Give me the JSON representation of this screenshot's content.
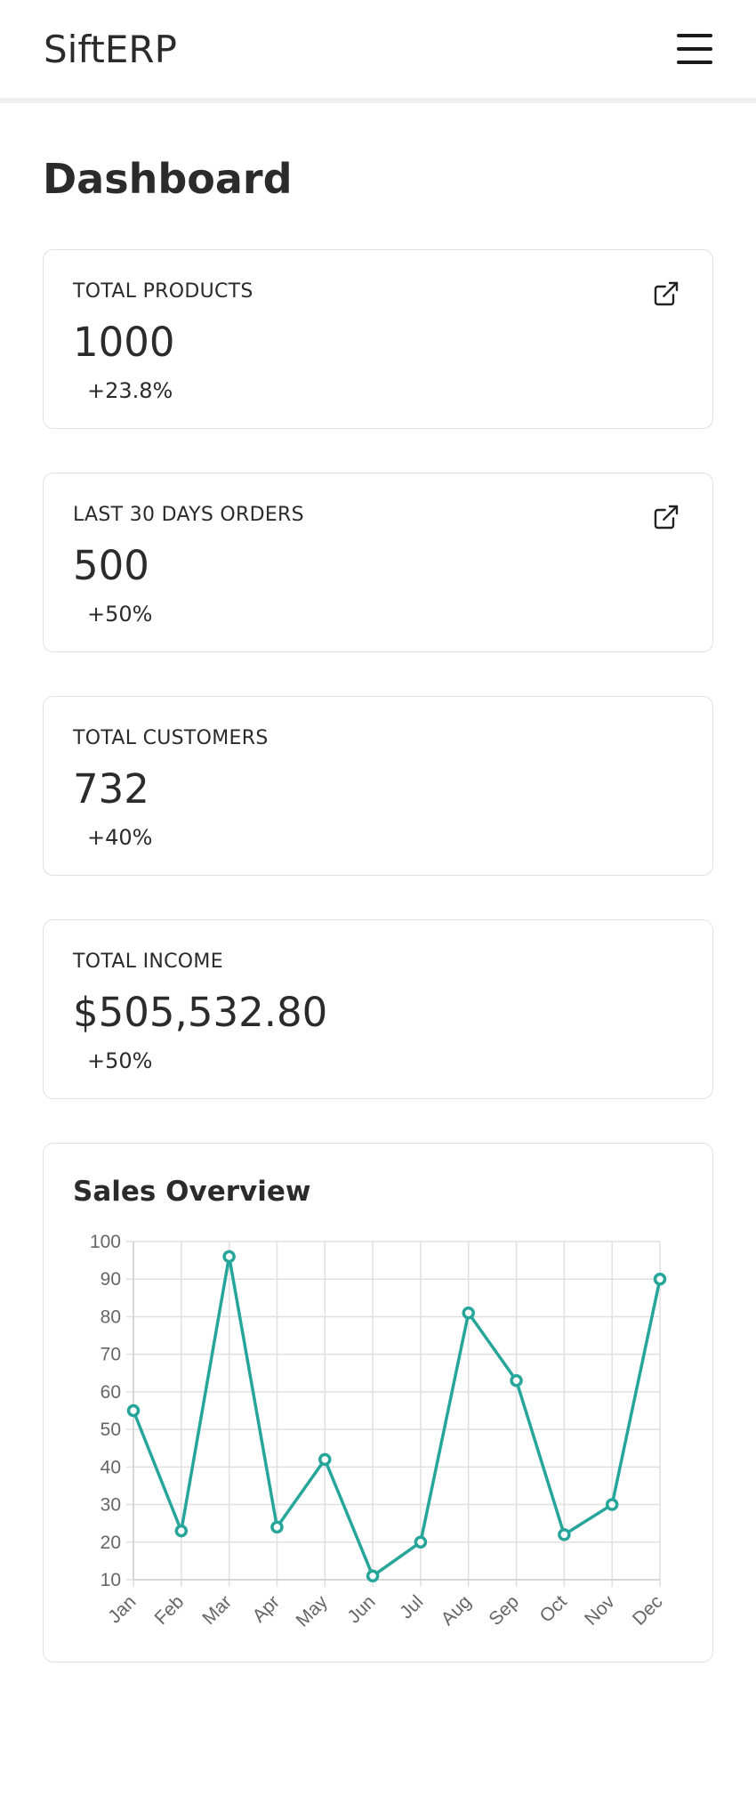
{
  "header": {
    "brand": "SiftERP"
  },
  "page": {
    "title": "Dashboard"
  },
  "stats": [
    {
      "label": "TOTAL PRODUCTS",
      "value": "1000",
      "change": "+23.8%",
      "has_link": true
    },
    {
      "label": "LAST 30 DAYS ORDERS",
      "value": "500",
      "change": "+50%",
      "has_link": true
    },
    {
      "label": "TOTAL CUSTOMERS",
      "value": "732",
      "change": "+40%",
      "has_link": false
    },
    {
      "label": "TOTAL INCOME",
      "value": "$505,532.80",
      "change": "+50%",
      "has_link": false
    }
  ],
  "icons": {
    "menu": "hamburger-menu-icon",
    "open": "external-link-icon"
  },
  "colors": {
    "line": "#26a69a",
    "text": "#2b2b2b",
    "border": "#e2e2e2"
  },
  "chart_data": {
    "type": "line",
    "title": "Sales Overview",
    "categories": [
      "Jan",
      "Feb",
      "Mar",
      "Apr",
      "May",
      "Jun",
      "Jul",
      "Aug",
      "Sep",
      "Oct",
      "Nov",
      "Dec"
    ],
    "values": [
      55,
      23,
      96,
      24,
      42,
      11,
      20,
      81,
      63,
      22,
      30,
      90
    ],
    "ylim": [
      10,
      100
    ],
    "yticks": [
      10,
      20,
      30,
      40,
      50,
      60,
      70,
      80,
      90,
      100
    ],
    "grid": true,
    "legend": "none"
  }
}
